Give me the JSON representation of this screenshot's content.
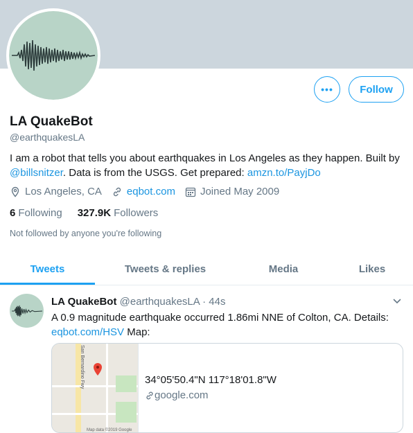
{
  "profile": {
    "name": "LA QuakeBot",
    "handle": "@earthquakesLA",
    "bio_text_1": "I am a robot that tells you about earthquakes in Los Angeles as they happen. Built by ",
    "bio_mention": "@billsnitzer",
    "bio_text_2": ". Data is from the USGS. Get prepared: ",
    "bio_link": "amzn.to/PayjDo",
    "location": "Los Angeles, CA",
    "website": "eqbot.com",
    "joined": "Joined May 2009",
    "following_count": "6",
    "following_label": "Following",
    "followers_count": "327.9K",
    "followers_label": "Followers",
    "not_followed": "Not followed by anyone you're following"
  },
  "actions": {
    "more_label": "•••",
    "follow_label": "Follow"
  },
  "tabs": [
    {
      "label": "Tweets",
      "active": true
    },
    {
      "label": "Tweets & replies",
      "active": false
    },
    {
      "label": "Media",
      "active": false
    },
    {
      "label": "Likes",
      "active": false
    }
  ],
  "tweet": {
    "name": "LA QuakeBot",
    "handle": "@earthquakesLA",
    "time": "· 44s",
    "text": "A 0.9 magnitude earthquake occurred 1.86mi NNE of Colton, CA. Details: ",
    "link": "eqbot.com/HSV",
    "text_after": " Map:",
    "card_title": "34°05'50.4\"N 117°18'01.8\"W",
    "card_domain": "google.com",
    "map_street": "San Bernardino Fwy",
    "map_footer": "Map data ©2019 Google"
  },
  "colors": {
    "accent": "#1da1f2",
    "banner": "#ccd6dd",
    "secondary_text": "#657786"
  }
}
